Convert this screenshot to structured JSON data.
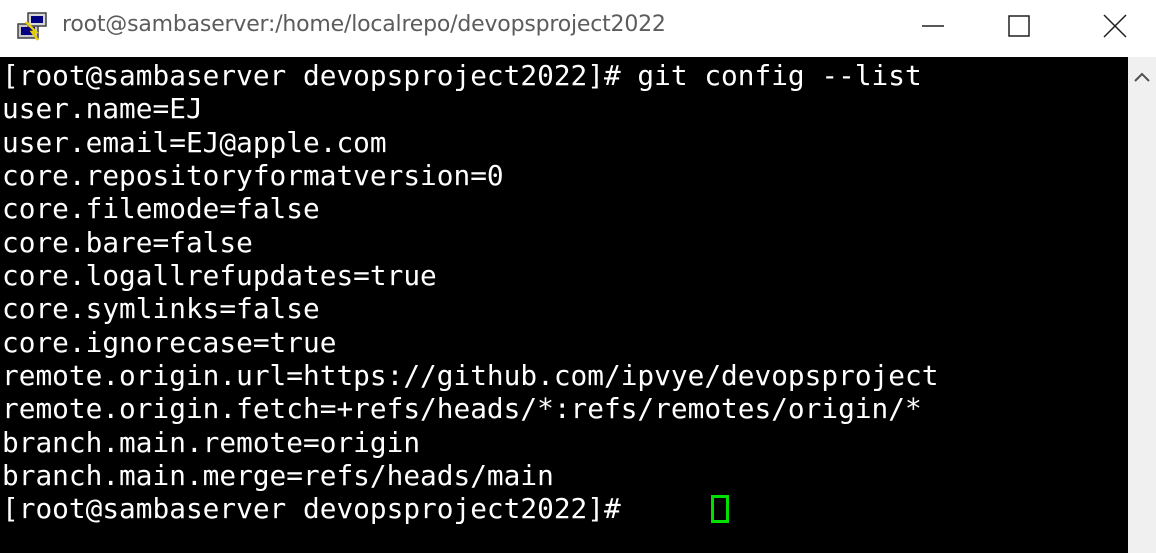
{
  "window": {
    "title": "root@sambaserver:/home/localrepo/devopsproject2022",
    "icon": "putty-icon"
  },
  "terminal": {
    "lines": [
      "[root@sambaserver devopsproject2022]# git config --list",
      "user.name=EJ",
      "user.email=EJ@apple.com",
      "core.repositoryformatversion=0",
      "core.filemode=false",
      "core.bare=false",
      "core.logallrefupdates=true",
      "core.symlinks=false",
      "core.ignorecase=true",
      "remote.origin.url=https://github.com/ipvye/devopsproject",
      "remote.origin.fetch=+refs/heads/*:refs/remotes/origin/*",
      "branch.main.remote=origin",
      "branch.main.merge=refs/heads/main",
      "[root@sambaserver devopsproject2022]# "
    ],
    "foreground": "#ffffff",
    "background": "#000000",
    "cursor_color": "#00e000"
  }
}
